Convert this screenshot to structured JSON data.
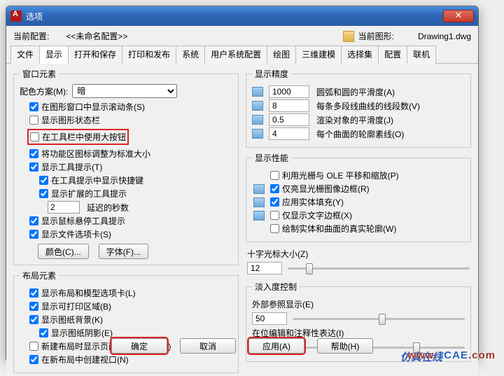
{
  "title": "选项",
  "header": {
    "current_profile_label": "当前配置:",
    "current_profile_value": "<<未命名配置>>",
    "current_drawing_label": "当前图形:",
    "current_drawing_value": "Drawing1.dwg"
  },
  "tabs": [
    "文件",
    "显示",
    "打开和保存",
    "打印和发布",
    "系统",
    "用户系统配置",
    "绘图",
    "三维建模",
    "选择集",
    "配置",
    "联机"
  ],
  "active_tab": 1,
  "window_elements": {
    "legend": "窗口元素",
    "scheme_label": "配色方案(M):",
    "scheme_value": "暗",
    "items": [
      {
        "label": "在图形窗口中显示滚动条(S)",
        "checked": true,
        "indent": 1
      },
      {
        "label": "显示图形状态栏",
        "checked": false,
        "indent": 1
      },
      {
        "label": "在工具栏中使用大按钮",
        "checked": false,
        "indent": 1,
        "highlight": true
      },
      {
        "label": "将功能区图标调整为标准大小",
        "checked": true,
        "indent": 1
      },
      {
        "label": "显示工具提示(T)",
        "checked": true,
        "indent": 1
      },
      {
        "label": "在工具提示中显示快捷键",
        "checked": true,
        "indent": 2
      },
      {
        "label": "显示扩展的工具提示",
        "checked": true,
        "indent": 2
      }
    ],
    "delay_value": "2",
    "delay_label": "延迟的秒数",
    "items2": [
      {
        "label": "显示鼠标悬停工具提示",
        "checked": true,
        "indent": 1
      },
      {
        "label": "显示文件选项卡(S)",
        "checked": true,
        "indent": 1
      }
    ],
    "color_btn": "颜色(C)...",
    "font_btn": "字体(F)..."
  },
  "layout_elements": {
    "legend": "布局元素",
    "items": [
      {
        "label": "显示布局和模型选项卡(L)",
        "checked": true
      },
      {
        "label": "显示可打印区域(B)",
        "checked": true
      },
      {
        "label": "显示图纸背景(K)",
        "checked": true
      },
      {
        "label": "显示图纸阴影(E)",
        "checked": true,
        "indent": 2
      },
      {
        "label": "新建布局时显示页面设置管理器(G)",
        "checked": false
      },
      {
        "label": "在新布局中创建视口(N)",
        "checked": true
      }
    ]
  },
  "display_precision": {
    "legend": "显示精度",
    "rows": [
      {
        "value": "1000",
        "label": "圆弧和圆的平滑度(A)"
      },
      {
        "value": "8",
        "label": "每条多段线曲线的线段数(V)"
      },
      {
        "value": "0.5",
        "label": "渲染对象的平滑度(J)"
      },
      {
        "value": "4",
        "label": "每个曲面的轮廓素线(O)"
      }
    ]
  },
  "display_perf": {
    "legend": "显示性能",
    "items": [
      {
        "label": "利用光栅与 OLE 平移和缩放(P)",
        "checked": false,
        "icon": false
      },
      {
        "label": "仅亮显光栅图像边框(R)",
        "checked": true,
        "icon": true
      },
      {
        "label": "应用实体填充(Y)",
        "checked": true,
        "icon": true
      },
      {
        "label": "仅显示文字边框(X)",
        "checked": false,
        "icon": true
      },
      {
        "label": "绘制实体和曲面的真实轮廓(W)",
        "checked": false,
        "icon": false
      }
    ]
  },
  "crosshair": {
    "label": "十字光标大小(Z)",
    "value": "12",
    "pct": 10
  },
  "fade": {
    "legend": "淡入度控制",
    "xref_label": "外部参照显示(E)",
    "xref_value": "50",
    "xref_pct": 50,
    "inplace_label": "在位编辑和注释性表达(I)",
    "inplace_value": "70",
    "inplace_pct": 70
  },
  "footer": {
    "ok": "确定",
    "cancel": "取消",
    "apply": "应用(A)",
    "help": "帮助(H)"
  },
  "watermark_site": "www.1CAE.com",
  "watermark_txt": "仿真在线"
}
